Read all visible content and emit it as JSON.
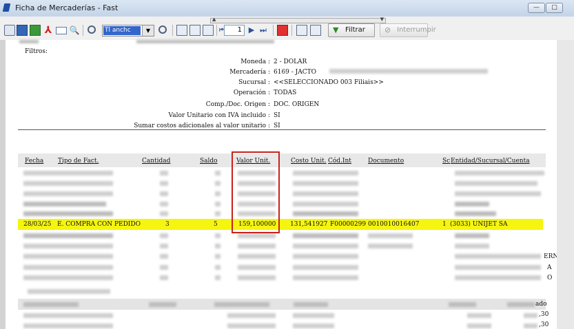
{
  "window": {
    "title": "Ficha de Mercaderías - Fast"
  },
  "toolbar": {
    "zoom_value": "Tl anchc",
    "page_number": "1",
    "filter_label": "Filtrar",
    "interrupt_label": "Interrumpir"
  },
  "report": {
    "filters_title": "Filtros:",
    "filters": [
      {
        "label": "Moneda :",
        "value": "2 - DOLAR"
      },
      {
        "label": "Mercadería :",
        "value": "6169 - JACTO"
      },
      {
        "label": "Sucursal :",
        "value": "<<SELECCIONADO 003 Filiais>>"
      },
      {
        "label": "Operación :",
        "value": "TODAS"
      },
      {
        "label": "Comp./Doc. Origen :",
        "value": "DOC. ORIGEN"
      },
      {
        "label": "Valor Unitario con IVA incluido :",
        "value": "SI"
      },
      {
        "label": "Sumar costos adicionales al valor unitario :",
        "value": "SI"
      }
    ],
    "columns": {
      "fecha": "Fecha",
      "tipo": "Tipo de Fact.",
      "cantidad": "Cantidad",
      "saldo": "Saldo",
      "valor_unit": "Valor Unit.",
      "costo_unit": "Costo Unit.",
      "cod_int": "Cód.Int",
      "documento": "Documento",
      "sc": "Sc",
      "entidad": "Entidad/Sucursal/Cuenta"
    },
    "highlighted_row": {
      "fecha": "28/03/25",
      "tipo": "E. COMPRA CON PEDIDO",
      "cantidad": "3",
      "saldo": "5",
      "valor_unit": "159,100000",
      "costo_unit": "131,541927",
      "cod_int": "F00000299",
      "documento": "0010010016407",
      "sc": "1",
      "entidad": "(3033) UNIJET SA"
    },
    "edge_fragments": [
      "ERN",
      "A",
      "O"
    ],
    "summary_header_right": "ado",
    "summary_values": [
      ",30",
      ",30"
    ]
  }
}
